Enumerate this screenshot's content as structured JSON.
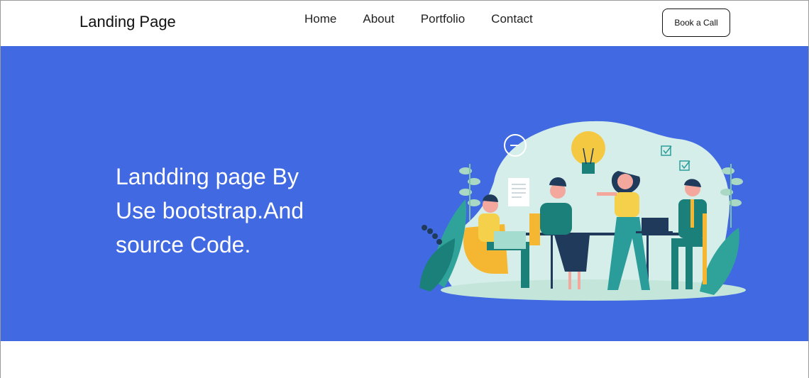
{
  "navbar": {
    "brand": "Landing Page",
    "links": [
      "Home",
      "About",
      "Portfolio",
      "Contact"
    ],
    "cta_label": "Book a Call"
  },
  "hero": {
    "heading_lines": [
      "Landding page By",
      "Use bootstrap.And",
      "source Code."
    ]
  },
  "colors": {
    "hero_bg": "#4169e1",
    "navbar_bg": "#ffffff",
    "illustration_blob": "#d6eee9",
    "accent_yellow": "#f5c842",
    "accent_teal": "#2a9d9b",
    "dark_navy": "#1f3a5a"
  }
}
